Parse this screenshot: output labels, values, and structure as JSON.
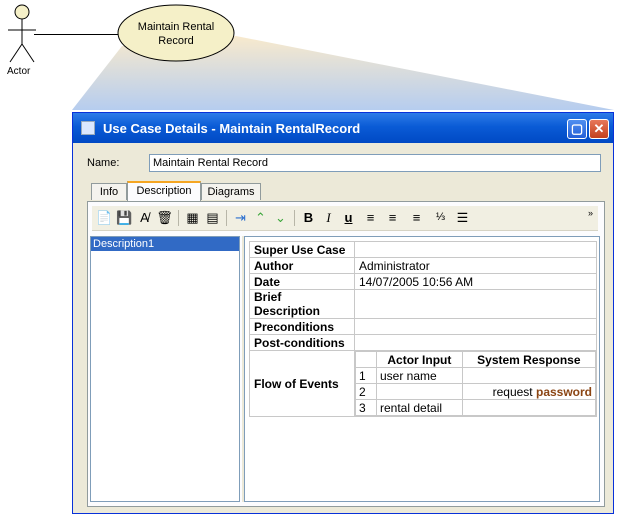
{
  "diagram": {
    "actor_label": "Actor",
    "usecase_line1": "Maintain Rental",
    "usecase_line2": "Record"
  },
  "window": {
    "title": "Use Case Details - Maintain RentalRecord",
    "name_label": "Name:",
    "name_value": "Maintain Rental Record"
  },
  "tabs": [
    {
      "label": "Info"
    },
    {
      "label": "Description"
    },
    {
      "label": "Diagrams"
    }
  ],
  "toolbar_icons": [
    "new-doc-icon",
    "save-icon",
    "spell-check-icon",
    "delete-icon",
    "insert-table-icon",
    "table-grid-icon",
    "insert-row-icon",
    "move-up-icon",
    "move-down-icon",
    "bold-icon",
    "italic-icon",
    "underline-icon",
    "align-left-icon",
    "align-center-icon",
    "align-right-icon",
    "numbered-list-icon",
    "bullet-list-icon"
  ],
  "list": {
    "items": [
      "Description1"
    ]
  },
  "details": {
    "super_use_case_label": "Super Use Case",
    "author_label": "Author",
    "author_value": "Administrator",
    "date_label": "Date",
    "date_value": "14/07/2005 10:56 AM",
    "brief_label": "Brief Description",
    "pre_label": "Preconditions",
    "post_label": "Post-conditions",
    "flow_label": "Flow of Events",
    "flow_headers": {
      "actor_input": "Actor Input",
      "system_response": "System Response"
    },
    "flow_rows": [
      {
        "n": "1",
        "actor": "user name",
        "system": ""
      },
      {
        "n": "2",
        "actor": "",
        "system_prefix": "request",
        "system_emph": "password"
      },
      {
        "n": "3",
        "actor": "rental detail",
        "system": ""
      }
    ]
  },
  "colors": {
    "title_bar": "#0a5bd6",
    "usecase_fill": "#f5f0c8",
    "highlight_word": "#8b4513",
    "selection": "#316ac5"
  }
}
